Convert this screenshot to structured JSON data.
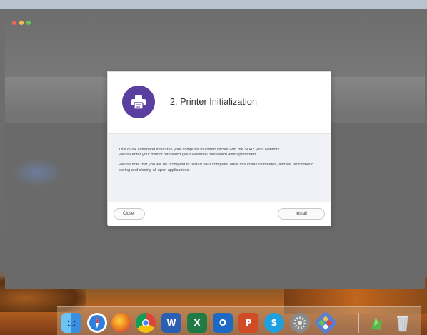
{
  "dialog": {
    "title": "2. Printer Initialization",
    "body_paragraph_1": "This quick command initializes your computer to communicate with the SD42 Print Network.",
    "body_paragraph_1b": "Please enter your district password (your Webmail password) when prompted.",
    "body_paragraph_2": "Please note that you will be prompted to restart your computer once this install completes, and we recommend saving and closing all open applications.",
    "close_label": "Close",
    "install_label": "Install",
    "accent_color": "#5b3fa0"
  },
  "dock": {
    "apps": [
      {
        "name": "Finder",
        "icon": "finder-icon",
        "color": "#3b8fe0"
      },
      {
        "name": "Safari",
        "icon": "safari-icon",
        "color": "#2f7fdc"
      },
      {
        "name": "Firefox",
        "icon": "firefox-icon",
        "color": "#e8701f"
      },
      {
        "name": "Chrome",
        "icon": "chrome-icon",
        "color": "#3aa757"
      },
      {
        "name": "Word",
        "icon": "word-icon",
        "color": "#2b5fb4",
        "glyph": "W"
      },
      {
        "name": "Excel",
        "icon": "excel-icon",
        "color": "#1f7a44",
        "glyph": "X"
      },
      {
        "name": "Outlook",
        "icon": "outlook-icon",
        "color": "#1d6ac4",
        "glyph": "O"
      },
      {
        "name": "PowerPoint",
        "icon": "powerpoint-icon",
        "color": "#d14b27",
        "glyph": "P"
      },
      {
        "name": "Skype",
        "icon": "skype-icon",
        "color": "#1fa0e0",
        "glyph": "S"
      },
      {
        "name": "System Preferences",
        "icon": "system-preferences-icon",
        "color": "#8a8a8a"
      },
      {
        "name": "Self Service",
        "icon": "self-service-icon",
        "color": "#5a7fd0"
      },
      {
        "name": "Maps",
        "icon": "maps-icon",
        "color": "#58b94a"
      },
      {
        "name": "Trash",
        "icon": "trash-icon",
        "color": "#cfd5da"
      }
    ]
  }
}
